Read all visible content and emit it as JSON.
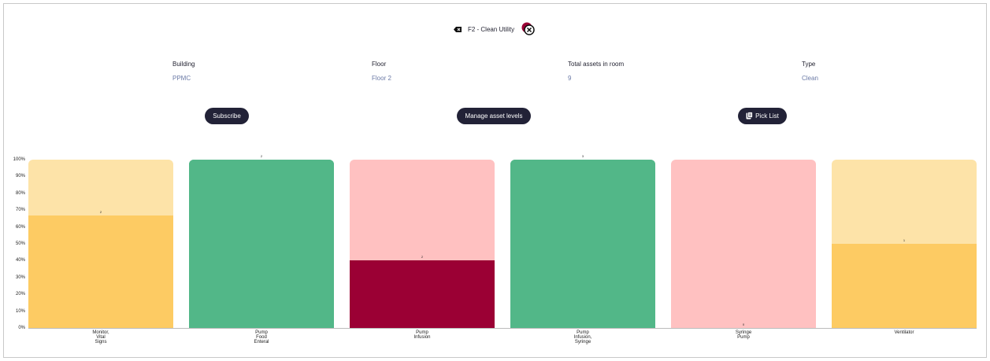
{
  "header": {
    "title": "F2 - Clean Utility",
    "back_icon": "backspace-icon",
    "close_icon": "close-circle-icon"
  },
  "info": {
    "building": {
      "label": "Building",
      "value": "PPMC"
    },
    "floor": {
      "label": "Floor",
      "value": "Floor 2"
    },
    "total": {
      "label": "Total assets in room",
      "value": "9"
    },
    "type": {
      "label": "Type",
      "value": "Clean"
    }
  },
  "buttons": {
    "subscribe": "Subscribe",
    "manage": "Manage asset levels",
    "picklist": "Pick List"
  },
  "colors": {
    "yellow_bg": "#fde3a8",
    "yellow_fill": "#fdcb63",
    "green": "#52b788",
    "pink_bg": "#ffc1c1",
    "red_fill": "#9b0034",
    "dark": "#222237"
  },
  "chart_data": {
    "type": "bar",
    "yticks": [
      "100%",
      "90%",
      "80%",
      "70%",
      "60%",
      "50%",
      "40%",
      "30%",
      "20%",
      "10%",
      "0%"
    ],
    "ylim": [
      0,
      100
    ],
    "bars": [
      {
        "category": "Monitor,\nVital\nSigns",
        "fill_percent": 67,
        "count_label": "2",
        "bg": "#fde3a8",
        "fill": "#fdcb63"
      },
      {
        "category": "Pump\nFood\nEnteral",
        "fill_percent": 100,
        "count_label": "2",
        "bg": "#52b788",
        "fill": "#52b788"
      },
      {
        "category": "Pump\nInfusion",
        "fill_percent": 40,
        "count_label": "2",
        "bg": "#ffc1c1",
        "fill": "#9b0034"
      },
      {
        "category": "Pump\nInfusion,\nSyringe",
        "fill_percent": 100,
        "count_label": "3",
        "bg": "#52b788",
        "fill": "#52b788"
      },
      {
        "category": "Syringe\nPump",
        "fill_percent": 0,
        "count_label": "0",
        "bg": "#ffc1c1",
        "fill": "#9b0034"
      },
      {
        "category": "Ventilator",
        "fill_percent": 50,
        "count_label": "1",
        "bg": "#fde3a8",
        "fill": "#fdcb63"
      }
    ]
  }
}
